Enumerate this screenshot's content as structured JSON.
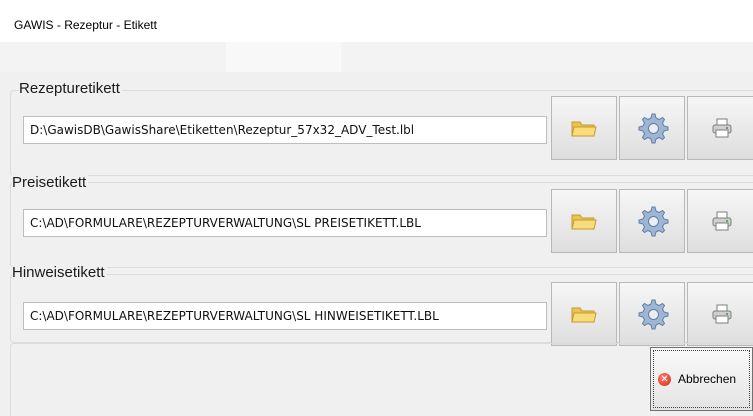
{
  "window": {
    "title": "GAWIS - Rezeptur - Etikett"
  },
  "groups": [
    {
      "label": "Rezepturetikett",
      "path": "D:\\GawisDB\\GawisShare\\Etiketten\\Rezeptur_57x32_ADV_Test.lbl"
    },
    {
      "label": "Preisetikett",
      "path": "C:\\AD\\FORMULARE\\REZEPTURVERWALTUNG\\SL  PREISETIKETT.LBL"
    },
    {
      "label": "Hinweisetikett",
      "path": "C:\\AD\\FORMULARE\\REZEPTURVERWALTUNG\\SL  HINWEISETIKETT.LBL"
    }
  ],
  "icons": {
    "browse": "folder-icon",
    "settings": "gear-icon",
    "print": "printer-icon",
    "cancel": "cancel-x-icon"
  },
  "footer": {
    "cancel_label": "Abbrechen"
  },
  "colors": {
    "folder": "#f5d56a",
    "gear": "#8aa7c9",
    "cancel": "#d42a1a"
  }
}
